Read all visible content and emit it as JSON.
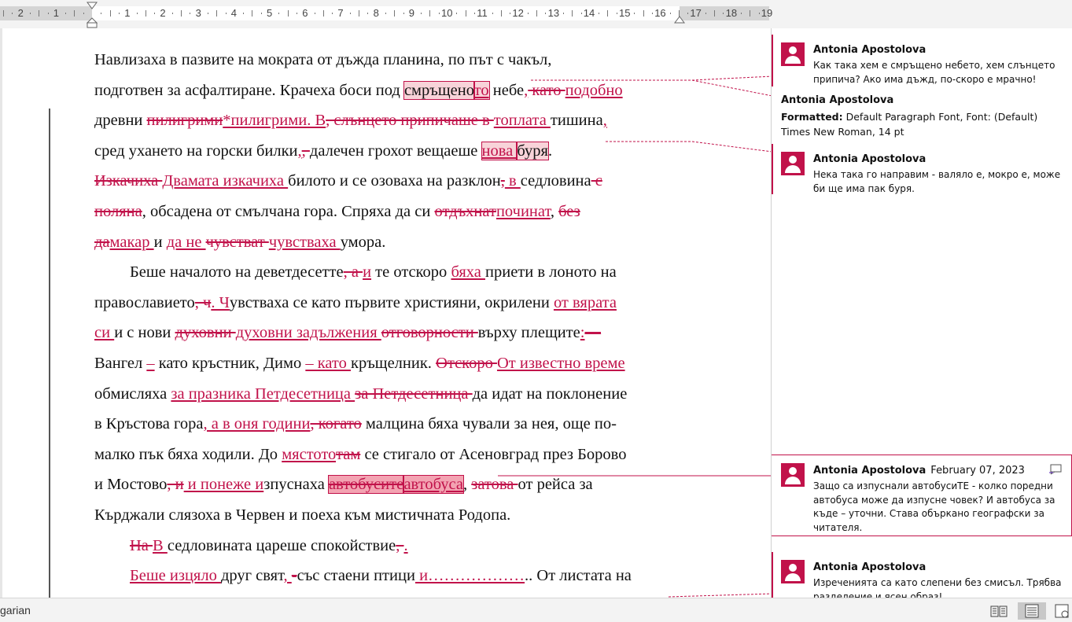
{
  "ruler": {
    "numbers": [
      "2",
      "1",
      "1",
      "2",
      "3",
      "4",
      "5",
      "6",
      "7",
      "8",
      "9",
      "10",
      "11",
      "12",
      "13",
      "14",
      "15",
      "16",
      "17",
      "18",
      "19"
    ]
  },
  "document": {
    "paragraphs": [
      {
        "runs": [
          {
            "t": "Навлизаха в пазвите на мократа от дъжда планина, по път с чакъл,",
            "k": "n"
          }
        ]
      },
      {
        "runs": [
          {
            "t": "подготвен за асфалтиране. Крачеха боси под ",
            "k": "n"
          },
          {
            "t": "смръщено",
            "k": "hn"
          },
          {
            "t": "то",
            "k": "hi"
          },
          {
            "t": " небе",
            "k": "n"
          },
          {
            "t": ",",
            "k": "i"
          },
          {
            "t": " като ",
            "k": "d"
          },
          {
            "t": "подобно",
            "k": "i"
          }
        ]
      },
      {
        "runs": [
          {
            "t": "древни ",
            "k": "n"
          },
          {
            "t": "пилигрими",
            "k": "d"
          },
          {
            "t": "*",
            "k": "i"
          },
          {
            "t": "пилигрими. В",
            "k": "i"
          },
          {
            "t": ", слънцето припичаше в ",
            "k": "d"
          },
          {
            "t": "топлата ",
            "k": "i"
          },
          {
            "t": "тишина",
            "k": "n"
          },
          {
            "t": ",",
            "k": "i"
          }
        ]
      },
      {
        "runs": [
          {
            "t": "сред ухането на горски билки",
            "k": "n"
          },
          {
            "t": ",",
            "k": "i"
          },
          {
            "t": ", ",
            "k": "d"
          },
          {
            "t": "далечен грохот вещаеше ",
            "k": "n"
          },
          {
            "t": "нова ",
            "k": "hi"
          },
          {
            "t": "буря",
            "k": "hn"
          },
          {
            "t": ".",
            "k": "n"
          }
        ]
      },
      {
        "runs": [
          {
            "t": "Изкачиха ",
            "k": "d"
          },
          {
            "t": "Двамата изкачиха ",
            "k": "i"
          },
          {
            "t": "билото и се озоваха на разклон",
            "k": "n"
          },
          {
            "t": ",",
            "k": "d"
          },
          {
            "t": " в ",
            "k": "i"
          },
          {
            "t": "седловина",
            "k": "n"
          },
          {
            "t": " с",
            "k": "d"
          }
        ]
      },
      {
        "runs": [
          {
            "t": "поляна",
            "k": "d"
          },
          {
            "t": ", обсадена от смълчана гора. Спряха да си ",
            "k": "n"
          },
          {
            "t": "отдъхнат",
            "k": "d"
          },
          {
            "t": "починат",
            "k": "i"
          },
          {
            "t": ", ",
            "k": "n"
          },
          {
            "t": "без",
            "k": "d"
          }
        ]
      },
      {
        "runs": [
          {
            "t": "да",
            "k": "d"
          },
          {
            "t": "макар ",
            "k": "i"
          },
          {
            "t": "и ",
            "k": "n"
          },
          {
            "t": "да не ",
            "k": "i"
          },
          {
            "t": "чувстват ",
            "k": "d"
          },
          {
            "t": "чувстваха ",
            "k": "i"
          },
          {
            "t": "умора.",
            "k": "n"
          }
        ]
      },
      {
        "indent": true,
        "runs": [
          {
            "t": "Беше началото на деветдесетте",
            "k": "n"
          },
          {
            "t": ", а ",
            "k": "d"
          },
          {
            "t": "и",
            "k": "i"
          },
          {
            "t": " те отскоро ",
            "k": "n"
          },
          {
            "t": "бяха ",
            "k": "i"
          },
          {
            "t": "приети в лоното на",
            "k": "n"
          }
        ]
      },
      {
        "runs": [
          {
            "t": "православието",
            "k": "n"
          },
          {
            "t": ", ч",
            "k": "d"
          },
          {
            "t": ". Ч",
            "k": "i"
          },
          {
            "t": "увстваха се като първите християни, окрилени ",
            "k": "n"
          },
          {
            "t": "от вярата",
            "k": "i"
          }
        ]
      },
      {
        "runs": [
          {
            "t": "си ",
            "k": "i"
          },
          {
            "t": "и с нови ",
            "k": "n"
          },
          {
            "t": "духовни ",
            "k": "d"
          },
          {
            "t": "духовни задължения ",
            "k": "i"
          },
          {
            "t": "отговорности ",
            "k": "d"
          },
          {
            "t": "върху плещите",
            "k": "n"
          },
          {
            "t": ":",
            "k": "i"
          },
          {
            "t": "—",
            "k": "d"
          }
        ]
      },
      {
        "runs": [
          {
            "t": "Вангел ",
            "k": "n"
          },
          {
            "t": "–",
            "k": "i"
          },
          {
            "t": " като кръстник, Димо ",
            "k": "n"
          },
          {
            "t": "– като ",
            "k": "i"
          },
          {
            "t": "кръщелник. ",
            "k": "n"
          },
          {
            "t": "Отскоро ",
            "k": "d"
          },
          {
            "t": "От известно време",
            "k": "i"
          }
        ]
      },
      {
        "runs": [
          {
            "t": "обмисляха ",
            "k": "n"
          },
          {
            "t": "за празника Петдесетница ",
            "k": "i"
          },
          {
            "t": "за Петдесетница ",
            "k": "d"
          },
          {
            "t": "да идат на поклонение",
            "k": "n"
          }
        ]
      },
      {
        "runs": [
          {
            "t": "в Кръстова гора",
            "k": "n"
          },
          {
            "t": ", а в оня години",
            "k": "i"
          },
          {
            "t": ", когато",
            "k": "d"
          },
          {
            "t": " малцина бяха чували за нея, още по-",
            "k": "n"
          }
        ]
      },
      {
        "runs": [
          {
            "t": "малко пък бяха ходили. До ",
            "k": "n"
          },
          {
            "t": "мястото",
            "k": "i"
          },
          {
            "t": "там",
            "k": "d"
          },
          {
            "t": " се стигало от Асеновград през Борово",
            "k": "n"
          }
        ]
      },
      {
        "runs": [
          {
            "t": "и Мостово",
            "k": "n"
          },
          {
            "t": ", и",
            "k": "d"
          },
          {
            "t": " и понеже и",
            "k": "i"
          },
          {
            "t": "зпуснаха ",
            "k": "n"
          },
          {
            "t": "автобусите",
            "k": "hd"
          },
          {
            "t": "автобуса",
            "k": "hi2"
          },
          {
            "t": ", ",
            "k": "n"
          },
          {
            "t": "затова ",
            "k": "d"
          },
          {
            "t": "от рейса за",
            "k": "n"
          }
        ]
      },
      {
        "runs": [
          {
            "t": "Кърджали слязоха в Червен и поеха към мистичната Родопа.",
            "k": "n"
          }
        ]
      },
      {
        "indent": true,
        "runs": [
          {
            "t": "На ",
            "k": "d"
          },
          {
            "t": "В ",
            "k": "i"
          },
          {
            "t": "седловината цареше спокойствие",
            "k": "n"
          },
          {
            "t": ", ",
            "k": "d"
          },
          {
            "t": ".",
            "k": "i"
          }
        ]
      },
      {
        "indent": true,
        "runs": [
          {
            "t": "Беше изцяло ",
            "k": "i"
          },
          {
            "t": "друг свят",
            "k": "n"
          },
          {
            "t": ", ",
            "k": "i"
          },
          {
            "t": "-",
            "k": "d"
          },
          {
            "t": "със стаени птици",
            "k": "n"
          },
          {
            "t": " и………………",
            "k": "i"
          },
          {
            "t": ".. От листата на",
            "k": "n"
          }
        ]
      }
    ]
  },
  "comments": [
    {
      "author": "Antonia Apostolova",
      "date": "",
      "text": "Как така хем е смръщено небето, хем слънцето припича? Ако има дъжд, по-скоро е мрачно!"
    },
    {
      "author": "Antonia Apostolova",
      "date": "",
      "text": "Нека така го направим - валяло е, мокро е, може би ще има пак буря."
    },
    {
      "author": "Antonia Apostolova",
      "date": "February 07, 2023",
      "text": "Защо са изпуснали автобусиТЕ - колко поредни автобуса може да изпусне човек? И автобуса за къде – уточни. Става объркано географски за читателя."
    },
    {
      "author": "Antonia Apostolova",
      "date": "",
      "text": "Изреченията са като слепени без смисъл. Трябва разделение и ясен образ!"
    }
  ],
  "format_change": {
    "author": "Antonia Apostolova",
    "label": "Formatted:",
    "detail": "Default Paragraph Font, Font: (Default) Times New Roman, 14 pt"
  },
  "statusbar": {
    "language": "garian",
    "views": [
      "read-mode-icon",
      "print-layout-icon",
      "web-layout-icon"
    ]
  },
  "colors": {
    "revision": "#c1124a"
  }
}
